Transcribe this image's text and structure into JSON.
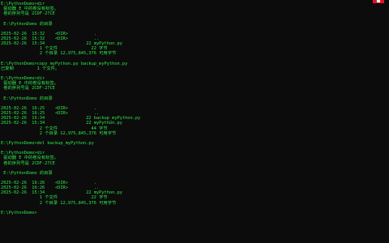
{
  "window": {
    "close_color": "#e81123",
    "text_color": "#2ee84a",
    "background_color": "#0c0c0c"
  },
  "console": {
    "lines": [
      "E:\\PythonDemo>dir",
      " 驱动器 E 中的卷没有标签。",
      " 卷的序列号是 2CDF-27CE",
      "",
      " E:\\PythonDemo 的目录",
      "",
      "2025-02-26  15:32    <DIR>          .",
      "2025-02-26  15:32    <DIR>          ..",
      "2025-02-26  15:34                22 myPython.py",
      "               1 个文件             22 字节",
      "               2 个目录 12,975,845,376 可用字节",
      "",
      "E:\\PythonDemo>copy myPython.py backup_myPython.py",
      "已复制         1 个文件。",
      "",
      "E:\\PythonDemo>dir",
      " 驱动器 E 中的卷没有标签。",
      " 卷的序列号是 2CDF-27CE",
      "",
      " E:\\PythonDemo 的目录",
      "",
      "2025-02-26  16:25    <DIR>          .",
      "2025-02-26  16:25    <DIR>          ..",
      "2025-02-26  15:34                22 backup_myPython.py",
      "2025-02-26  15:34                22 myPython.py",
      "               2 个文件             44 字节",
      "               2 个目录 12,975,845,376 可用字节",
      "",
      "E:\\PythonDemo>del backup_myPython.py",
      "",
      "E:\\PythonDemo>dir",
      " 驱动器 E 中的卷没有标签。",
      " 卷的序列号是 2CDF-27CE",
      "",
      " E:\\PythonDemo 的目录",
      "",
      "2025-02-26  16:26    <DIR>          .",
      "2025-02-26  16:26    <DIR>          ..",
      "2025-02-26  15:34                22 myPython.py",
      "               1 个文件             22 字节",
      "               2 个目录 12,975,845,376 可用字节",
      "",
      "E:\\PythonDemo>"
    ]
  }
}
